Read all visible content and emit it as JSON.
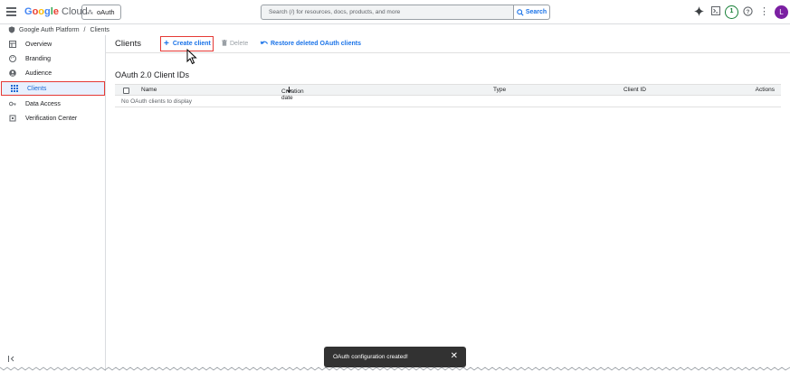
{
  "header": {
    "logo_google": "Google",
    "logo_cloud": "Cloud",
    "project_label": "oAuth",
    "search_placeholder": "Search (/) for resources, docs, products, and more",
    "search_button": "Search",
    "notification_count": "1",
    "avatar_initial": "L",
    "icons": [
      "menu-icon",
      "project-switch-icon",
      "search-icon",
      "gemini-icon",
      "cloud-shell-icon",
      "help-icon",
      "more-vert-icon"
    ]
  },
  "breadcrumb": {
    "items": [
      "Google Auth Platform",
      "Clients"
    ],
    "separator": "/"
  },
  "sidebar": {
    "items": [
      {
        "label": "Overview",
        "icon": "dashboard-icon"
      },
      {
        "label": "Branding",
        "icon": "palette-icon"
      },
      {
        "label": "Audience",
        "icon": "people-icon"
      },
      {
        "label": "Clients",
        "icon": "grid-icon",
        "active": true
      },
      {
        "label": "Data Access",
        "icon": "key-icon"
      },
      {
        "label": "Verification Center",
        "icon": "verify-icon"
      }
    ],
    "collapse_icon": "collapse-icon"
  },
  "main": {
    "title": "Clients",
    "actions": {
      "create": "Create client",
      "delete": "Delete",
      "restore": "Restore deleted OAuth clients"
    },
    "section_title": "OAuth 2.0 Client IDs",
    "table": {
      "columns": [
        "Name",
        "Creation date",
        "Type",
        "Client ID",
        "Actions"
      ],
      "sort_column": "Creation date",
      "empty_message": "No OAuth clients to display"
    }
  },
  "snackbar": {
    "message": "OAuth configuration created!"
  },
  "colors": {
    "accent": "#1a73e8",
    "highlight": "#e53935",
    "active_bg": "#e8f0fe"
  }
}
